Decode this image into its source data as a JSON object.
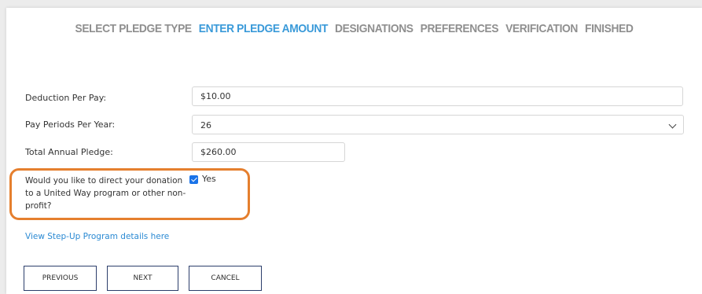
{
  "steps": {
    "items": [
      {
        "label": "SELECT PLEDGE TYPE"
      },
      {
        "label": "ENTER PLEDGE AMOUNT"
      },
      {
        "label": "DESIGNATIONS"
      },
      {
        "label": "PREFERENCES"
      },
      {
        "label": "VERIFICATION"
      },
      {
        "label": "FINISHED"
      }
    ],
    "active_index": 1,
    "active_color": "#3a9ad9",
    "inactive_color": "#8f8f8f"
  },
  "form": {
    "deduction": {
      "label": "Deduction Per Pay:",
      "value": "$10.00"
    },
    "pay_periods": {
      "label": "Pay Periods Per Year:",
      "value": "26"
    },
    "total_annual": {
      "label": "Total Annual Pledge:",
      "value": "$260.00"
    },
    "direct_donation": {
      "question": "Would you like to direct your donation to a United Way program or other non-profit?",
      "checkbox_label": "Yes",
      "checked": true
    }
  },
  "link": {
    "label": "View Step-Up Program details here"
  },
  "buttons": {
    "previous": "PREVIOUS",
    "next": "NEXT",
    "cancel": "CANCEL"
  },
  "colors": {
    "highlight": "#e57f2e",
    "link": "#2b8ad3",
    "checkbox": "#1a73e8",
    "button_border": "#2c3e6b"
  }
}
